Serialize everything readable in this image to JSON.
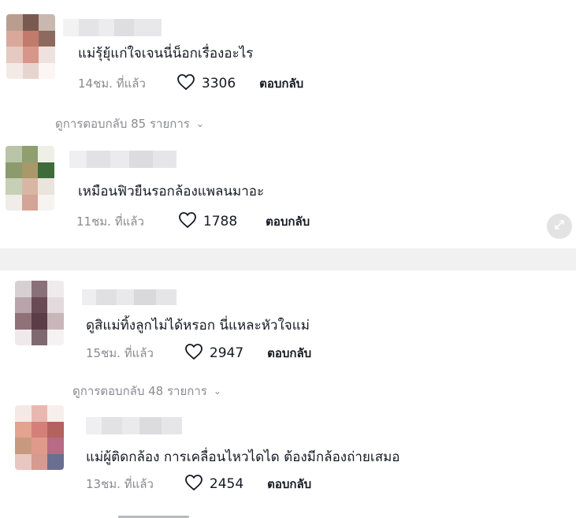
{
  "comments": [
    {
      "text": "แม่รุ้ยุ้แก่ใจเจนนี่น็อกเรื่องอะไร",
      "time": "14ชม. ที่แล้ว",
      "likes": "3306",
      "reply_label": "ตอบกลับ",
      "view_replies": "ดูการตอบกลับ 85 รายการ"
    },
    {
      "text": "เหมือนฟิวยืนรอกล้องแพลนมาอะ",
      "time": "11ชม. ที่แล้ว",
      "likes": "1788",
      "reply_label": "ตอบกลับ"
    },
    {
      "text": "ดูสิแม่ทิ้งลูกไม่ได้หรอก นี่แหละหัวใจแม่",
      "time": "15ชม. ที่แล้ว",
      "likes": "2947",
      "reply_label": "ตอบกลับ",
      "view_replies": "ดูการตอบกลับ 48 รายการ"
    },
    {
      "text": "แม่ผู้ติดกล้อง การเคลื่อนไหวไดได ต้องมีกล้องถ่ายเสมอ",
      "time": "13ชม. ที่แล้ว",
      "likes": "2454",
      "reply_label": "ตอบกลับ"
    }
  ],
  "icons": {
    "like": "heart-icon",
    "chevron": "chevron-down-icon",
    "expand": "expand-icon"
  },
  "colors": {
    "text": "#161823",
    "muted": "#8a8b91",
    "divider": "#f1f1f2"
  }
}
